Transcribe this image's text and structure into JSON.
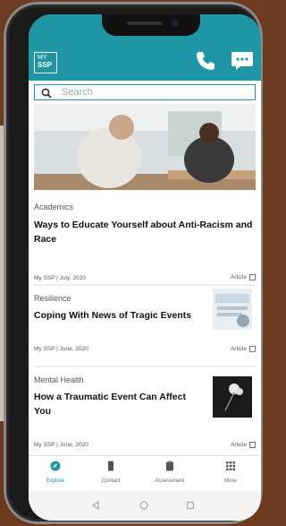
{
  "app": {
    "logo_line1": "MY",
    "logo_line2": "SSP"
  },
  "search": {
    "placeholder": "Search"
  },
  "articles": [
    {
      "category": "Academics",
      "title": "Ways to Educate Yourself about Anti-Racism and Race",
      "meta": "My SSP | July, 2020",
      "kind": "Article"
    },
    {
      "category": "Resilience",
      "title": "Coping With News of Tragic Events",
      "meta": "My SSP | June, 2020",
      "kind": "Article"
    },
    {
      "category": "Mental Health",
      "title": "How a Traumatic Event Can Affect You",
      "meta": "My SSP | June, 2020",
      "kind": "Article"
    }
  ],
  "nav": [
    {
      "label": "Explore",
      "icon": "compass-icon",
      "active": true
    },
    {
      "label": "Contact",
      "icon": "phone-handset-icon",
      "active": false
    },
    {
      "label": "Assessment",
      "icon": "clipboard-icon",
      "active": false
    },
    {
      "label": "More",
      "icon": "grid-icon",
      "active": false
    }
  ],
  "colors": {
    "accent": "#1f96a6"
  }
}
